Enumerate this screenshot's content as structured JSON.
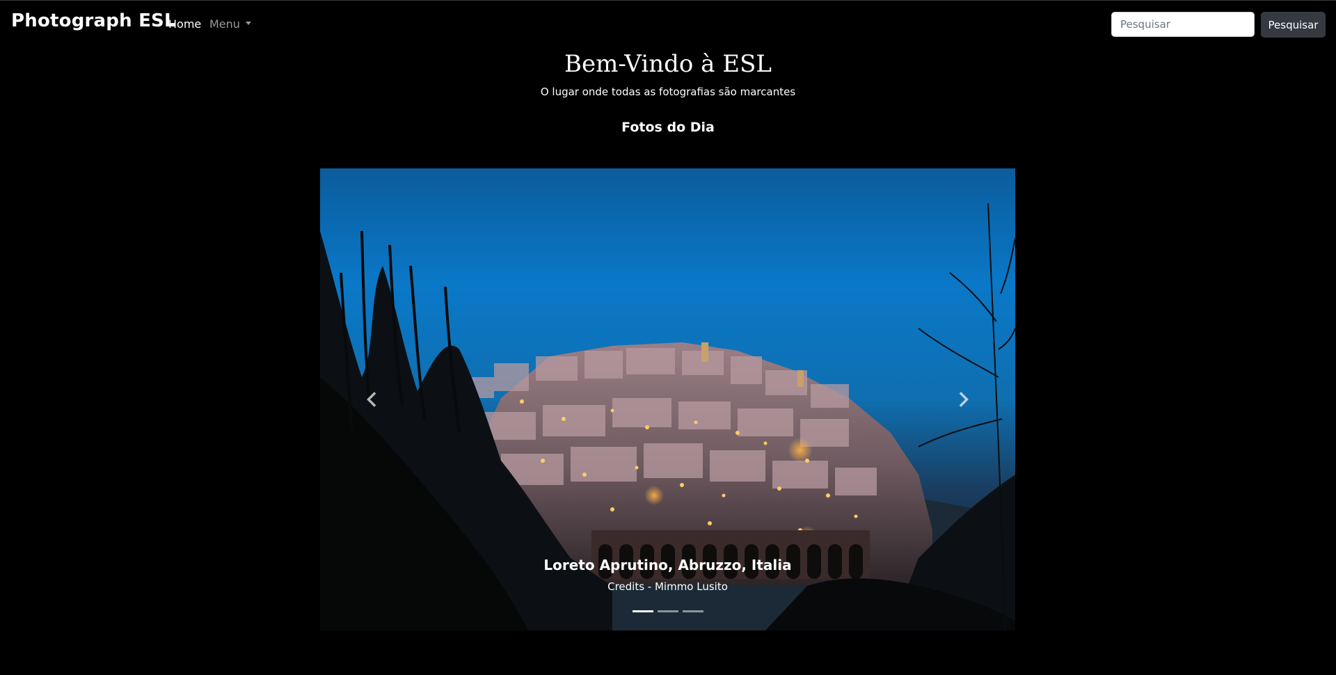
{
  "navbar": {
    "brand": "Photograph ESL",
    "home_label": "Home",
    "menu_label": "Menu",
    "search": {
      "placeholder": "Pesquisar",
      "button_label": "Pesquisar"
    }
  },
  "hero": {
    "title": "Bem-Vindo à ESL",
    "subtitle": "O lugar onde todas as fotografias são marcantes"
  },
  "section": {
    "title": "Fotos do Dia"
  },
  "carousel": {
    "active_index": 0,
    "slides": [
      {
        "caption_title": "Loreto Aprutino, Abruzzo, Italia",
        "caption_credit": "Credits - Mimmo Lusito"
      }
    ],
    "indicator_count": 3
  },
  "colors": {
    "page_background": "#000000",
    "search_button_background": "#343a40",
    "sky_top": "#0b5d9e",
    "sky_mid": "#0a77c7"
  },
  "icons": {
    "prev": "chevron-left-icon",
    "next": "chevron-right-icon",
    "menu_caret": "caret-down-icon"
  }
}
